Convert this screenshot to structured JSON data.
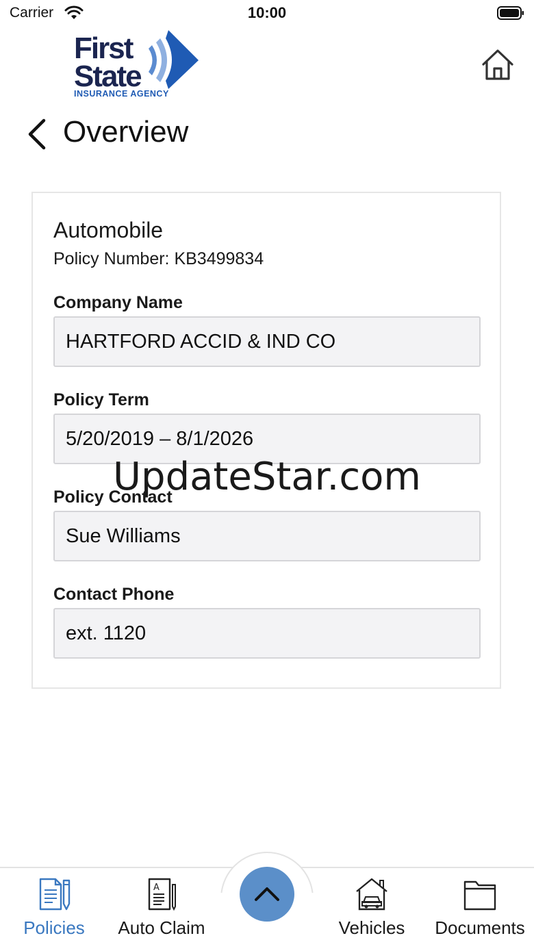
{
  "status_bar": {
    "carrier": "Carrier",
    "time": "10:00"
  },
  "brand": {
    "line1": "First",
    "line2": "State",
    "line3": "INSURANCE AGENCY",
    "colors": {
      "navy": "#1b2550",
      "blue": "#1f5bb4"
    }
  },
  "header": {
    "title": "Overview"
  },
  "policy": {
    "type": "Automobile",
    "number_text": "Policy Number: KB3499834",
    "fields": [
      {
        "label": "Company Name",
        "value": "HARTFORD ACCID & IND CO"
      },
      {
        "label": "Policy Term",
        "value": "5/20/2019 – 8/1/2026"
      },
      {
        "label": "Policy Contact",
        "value": "Sue Williams"
      },
      {
        "label": "Contact Phone",
        "value": "ext. 1120"
      }
    ]
  },
  "watermark": "UpdateStar.com",
  "tabbar": {
    "accent": "#3a78c0",
    "fab_color": "#5b8fc9",
    "tabs": [
      {
        "label": "Policies",
        "icon": "policies-icon",
        "active": true
      },
      {
        "label": "Auto Claim",
        "icon": "auto-claim-icon",
        "active": false
      },
      {
        "label": "Vehicles",
        "icon": "vehicles-icon",
        "active": false
      },
      {
        "label": "Documents",
        "icon": "documents-icon",
        "active": false
      }
    ]
  }
}
